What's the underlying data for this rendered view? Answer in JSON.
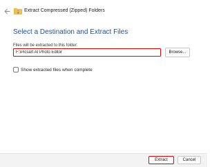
{
  "window": {
    "title": "Extract Compressed (Zipped) Folders",
    "back_icon": "back-arrow-icon",
    "title_icon": "zip-folder-icon"
  },
  "main": {
    "heading": "Select a Destination and Extract Files",
    "destination": {
      "label": "Files will be extracted to this folder:",
      "value": "F:\\Picsart AI Photo Editor",
      "highlight_color": "#e60000"
    },
    "browse_label": "Browse...",
    "show_files_checkbox": {
      "label": "Show extracted files when complete",
      "checked": false
    }
  },
  "footer": {
    "extract_label": "Extract",
    "cancel_label": "Cancel"
  },
  "colors": {
    "heading": "#1f4fa3",
    "highlight": "#e60000",
    "footer_bg": "#f3f3f3"
  }
}
